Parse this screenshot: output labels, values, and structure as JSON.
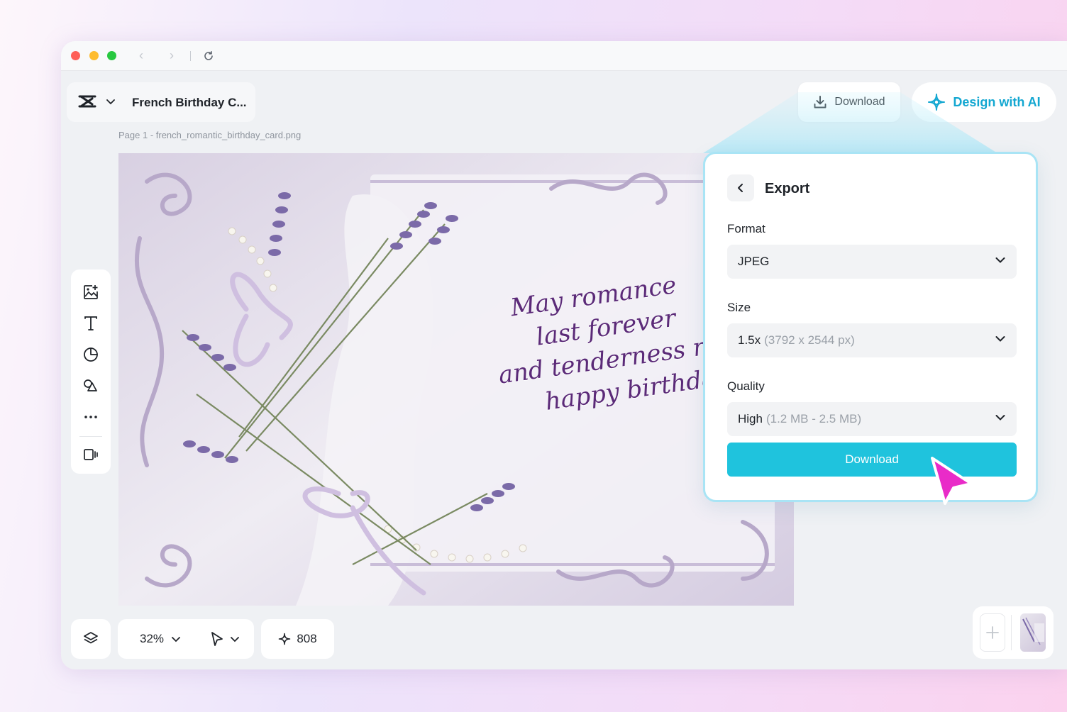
{
  "project": {
    "title": "French Birthday C...",
    "breadcrumb": "Page 1 -  french_romantic_birthday_card.png"
  },
  "header": {
    "download_label": "Download",
    "ai_label": "Design with AI"
  },
  "card": {
    "lines": [
      "May romance",
      "last forever",
      "and tenderness remain,",
      "happy birthday!"
    ]
  },
  "export": {
    "title": "Export",
    "format_label": "Format",
    "format_value": "JPEG",
    "size_label": "Size",
    "size_value": "1.5x",
    "size_detail": "(3792 x 2544 px)",
    "quality_label": "Quality",
    "quality_value": "High",
    "quality_detail": "(1.2 MB - 2.5 MB)",
    "download_label": "Download"
  },
  "bottom": {
    "zoom": "32%",
    "credits": "808"
  },
  "colors": {
    "accent": "#1fc3dd",
    "ai_text": "#13a7d1",
    "cursor": "#e92bc8",
    "script_text": "#5b2a78"
  },
  "icons": {
    "toolbar": [
      "add-image-icon",
      "text-icon",
      "sticker-icon",
      "shapes-icon",
      "more-icon",
      "video-panel-icon"
    ]
  }
}
